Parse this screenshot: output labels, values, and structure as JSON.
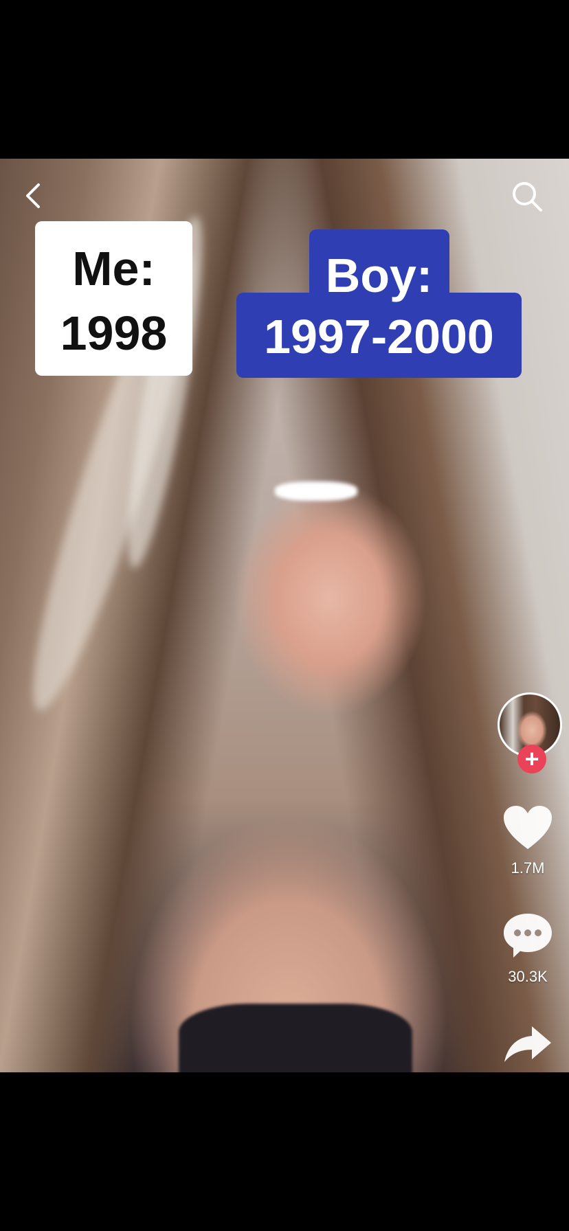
{
  "top_bar": {
    "back_icon": "chevron-left-icon",
    "search_icon": "search-icon"
  },
  "stickers": {
    "me_line1": "Me:",
    "me_line2": "1998",
    "boy_line1": "Boy:",
    "boy_line2": "1997-2000",
    "boy_color": "#2f3fb3"
  },
  "sidebar": {
    "follow_icon": "plus-icon",
    "follow_label": "+",
    "follow_color": "#ea4359",
    "like_icon": "heart-icon",
    "like_count": "1.7M",
    "comment_icon": "comment-bubble-icon",
    "comment_count": "30.3K",
    "share_icon": "share-arrow-icon"
  }
}
